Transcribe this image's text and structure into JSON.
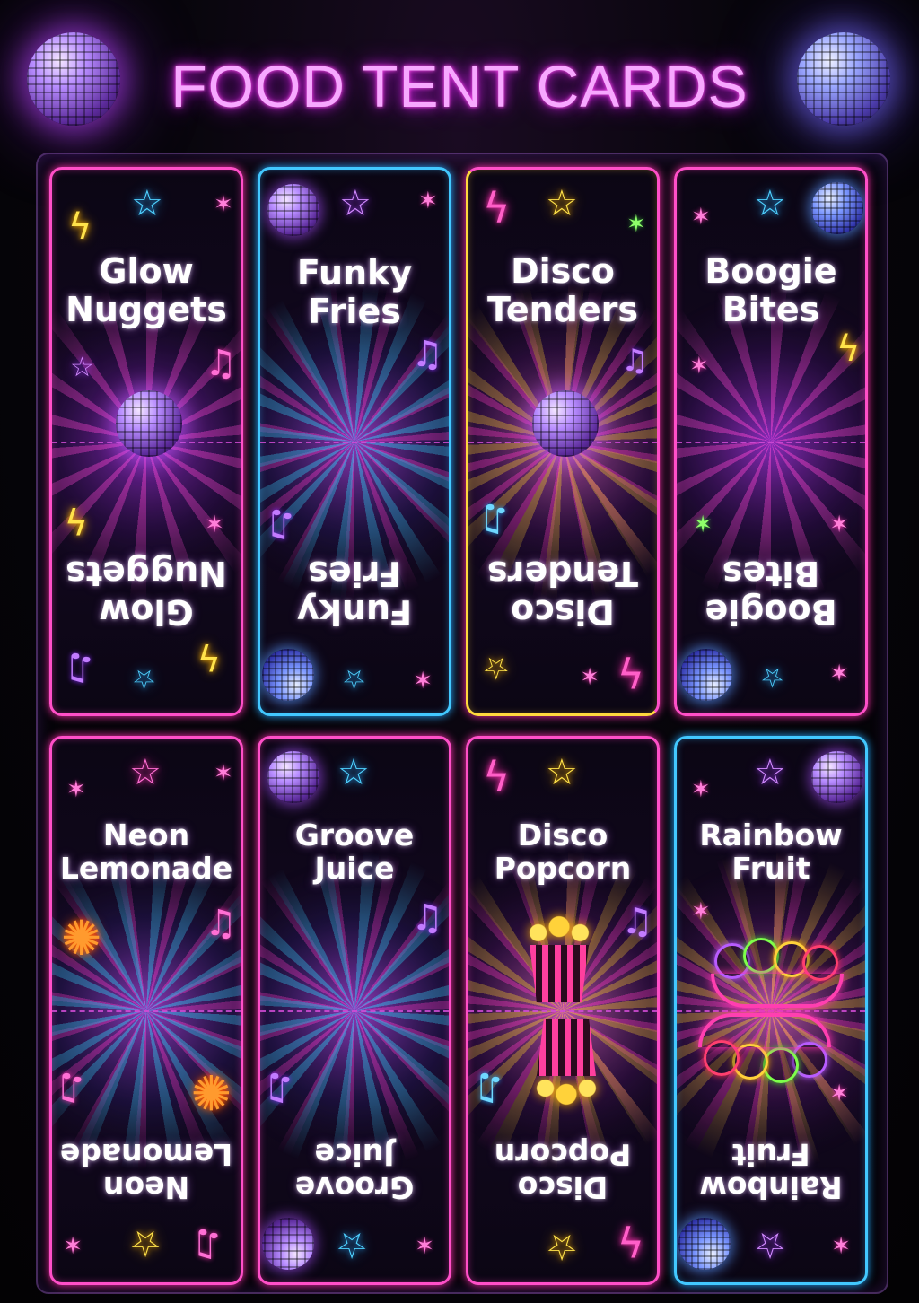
{
  "title": "FOOD TENT CARDS",
  "cards": [
    {
      "line1": "Glow",
      "line2": "Nuggets"
    },
    {
      "line1": "Funky",
      "line2": "Fries"
    },
    {
      "line1": "Disco",
      "line2": "Tenders"
    },
    {
      "line1": "Boogie",
      "line2": "Bites"
    },
    {
      "line1": "Neon",
      "line2": "Lemonade"
    },
    {
      "line1": "Groove",
      "line2": "Juice"
    },
    {
      "line1": "Disco",
      "line2": "Popcorn"
    },
    {
      "line1": "Rainbow",
      "line2": "Fruit"
    }
  ],
  "colors": {
    "title_glow": "#ff4df0",
    "pink": "#ff4fc8",
    "blue": "#42c8ff",
    "gold": "#ffd93d"
  },
  "icons": [
    "disco-ball-icon",
    "star-icon",
    "lightning-bolt-icon",
    "music-note-icon",
    "sparkle-icon",
    "firework-icon",
    "popcorn-icon",
    "fruit-bowl-icon"
  ]
}
